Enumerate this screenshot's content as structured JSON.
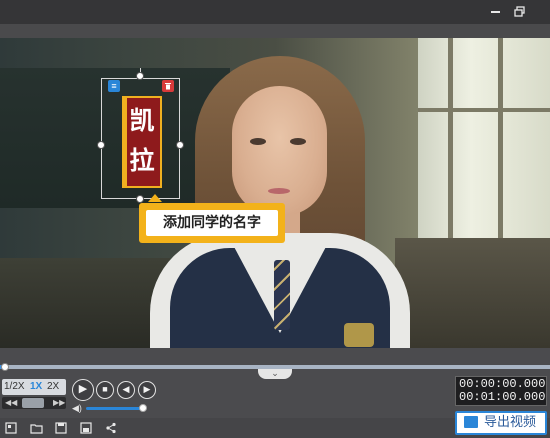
{
  "window": {
    "close_icon": "×",
    "restore_icon": "restore-icon"
  },
  "sticker": {
    "chars": [
      "凯",
      "拉"
    ],
    "menu_icon": "≡",
    "delete_icon": "🗑"
  },
  "tooltip": {
    "text": "添加同学的名字"
  },
  "controls": {
    "collapse_icon": "⌄",
    "speed_options": [
      "1/2X",
      "1X",
      "2X"
    ],
    "speed_active": "1X",
    "speed_left_arrow": "◀◀",
    "speed_right_arrow": "▶▶",
    "play_icon": "▶",
    "stop_icon": "■",
    "prev_icon": "◀",
    "next_icon": "▶",
    "volume_icon": "◀)",
    "volume_level": 0.9,
    "progress": 0.01,
    "current_time": "00:00:00.000",
    "total_time": "00:01:00.000"
  },
  "toolbar": {
    "tools": [
      {
        "name": "new-project-icon",
        "glyph": "▦"
      },
      {
        "name": "open-folder-icon",
        "glyph": "▭"
      },
      {
        "name": "save-icon",
        "glyph": "▣"
      },
      {
        "name": "save-as-icon",
        "glyph": "◪"
      },
      {
        "name": "share-icon",
        "glyph": "⋖"
      }
    ],
    "export_label": "导出视频"
  },
  "colors": {
    "accent": "#2a86d8",
    "tooltip": "#f3b21a",
    "sticker_bg": "#8e1a1c",
    "sticker_border": "#f0b020"
  }
}
